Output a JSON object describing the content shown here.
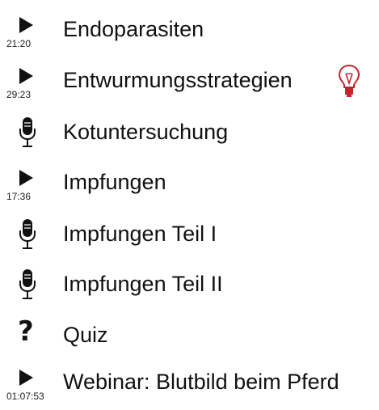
{
  "icon_colors": {
    "default": "#111111",
    "bulb": "#c0272d"
  },
  "items": [
    {
      "title": "Endoparasiten",
      "type": "video",
      "icon": "play-icon",
      "duration": "21:20"
    },
    {
      "title": "Entwurmungsstrategien",
      "type": "video",
      "icon": "play-icon",
      "duration": "29:23",
      "badge_icon": "lightbulb-icon"
    },
    {
      "title": "Kotuntersuchung",
      "type": "audio",
      "icon": "microphone-icon"
    },
    {
      "title": "Impfungen",
      "type": "video",
      "icon": "play-icon",
      "duration": "17:36"
    },
    {
      "title": "Impfungen Teil I",
      "type": "audio",
      "icon": "microphone-icon"
    },
    {
      "title": "Impfungen Teil II",
      "type": "audio",
      "icon": "microphone-icon"
    },
    {
      "title": "Quiz",
      "type": "quiz",
      "icon": "question-mark-icon",
      "glyph": "?"
    },
    {
      "title": "Webinar: Blutbild beim Pferd",
      "type": "video",
      "icon": "play-icon",
      "duration": "01:07:53"
    }
  ]
}
